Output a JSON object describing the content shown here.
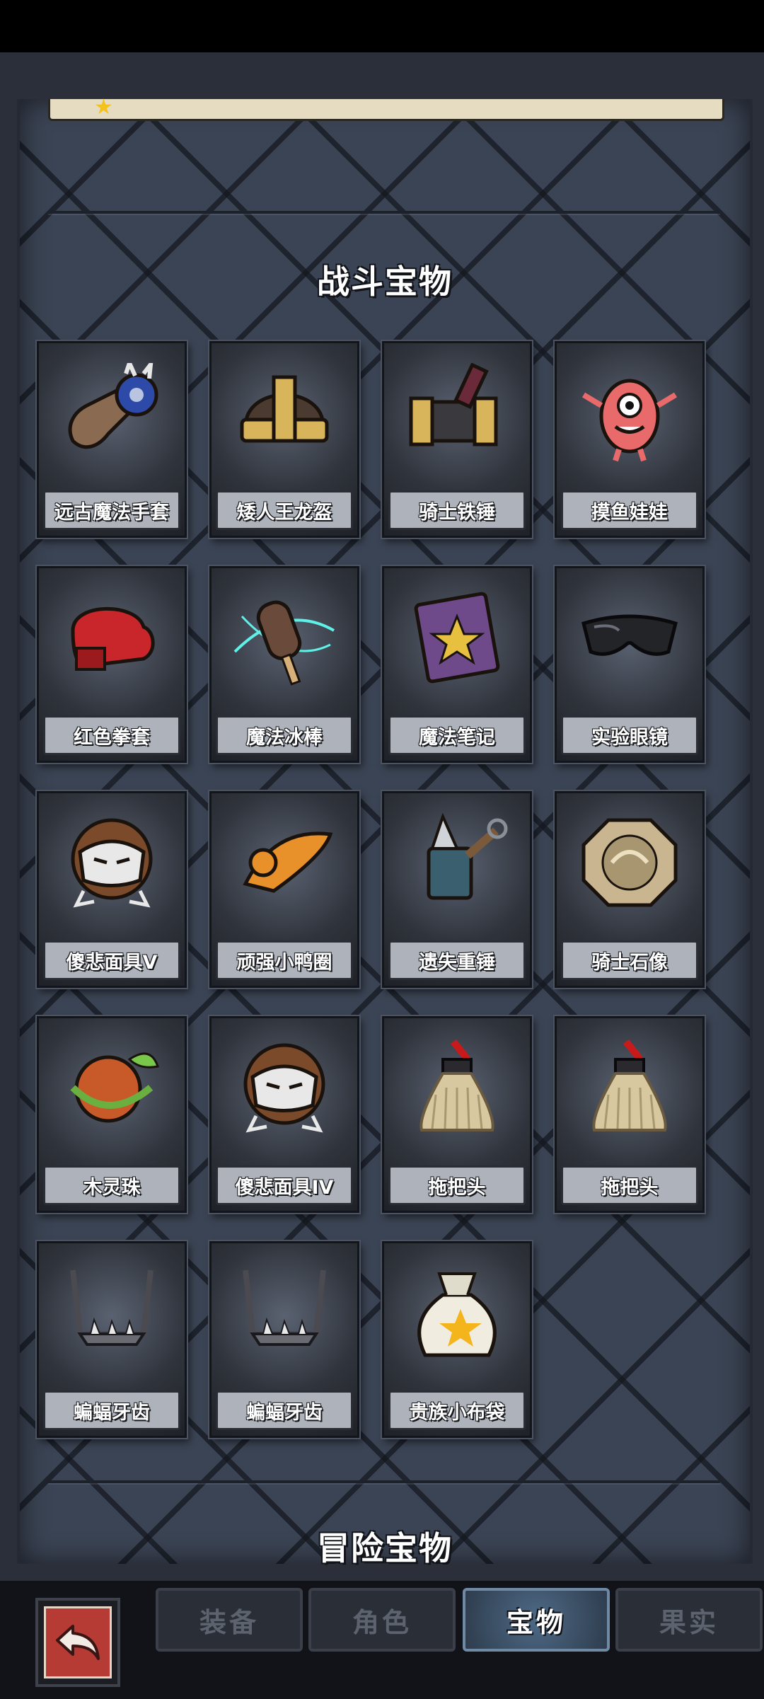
{
  "sections": {
    "battle_title": "战斗宝物",
    "adventure_title": "冒险宝物"
  },
  "treasures": [
    {
      "label": "远古魔法手套",
      "icon": "gauntlet-icon"
    },
    {
      "label": "矮人王龙盔",
      "icon": "helmet-icon"
    },
    {
      "label": "骑士铁锤",
      "icon": "hammer-icon"
    },
    {
      "label": "摸鱼娃娃",
      "icon": "pink-doll-icon"
    },
    {
      "label": "红色拳套",
      "icon": "boxing-glove-icon"
    },
    {
      "label": "魔法冰棒",
      "icon": "ice-pop-icon"
    },
    {
      "label": "魔法笔记",
      "icon": "spellbook-icon"
    },
    {
      "label": "实验眼镜",
      "icon": "goggles-icon"
    },
    {
      "label": "傻悲面具V",
      "icon": "sad-mask-icon"
    },
    {
      "label": "顽强小鸭圈",
      "icon": "duck-ring-icon"
    },
    {
      "label": "遗失重锤",
      "icon": "spiked-hammer-icon"
    },
    {
      "label": "骑士石像",
      "icon": "stone-emblem-icon"
    },
    {
      "label": "木灵珠",
      "icon": "wood-orb-icon"
    },
    {
      "label": "傻悲面具IV",
      "icon": "sad-mask-icon"
    },
    {
      "label": "拖把头",
      "icon": "mop-head-icon"
    },
    {
      "label": "拖把头",
      "icon": "mop-head-icon"
    },
    {
      "label": "蝙蝠牙齿",
      "icon": "bat-teeth-icon"
    },
    {
      "label": "蝙蝠牙齿",
      "icon": "bat-teeth-icon"
    },
    {
      "label": "贵族小布袋",
      "icon": "cloth-bag-icon"
    }
  ],
  "tabs": [
    {
      "label": "装备",
      "active": false
    },
    {
      "label": "角色",
      "active": false
    },
    {
      "label": "宝物",
      "active": true
    },
    {
      "label": "果实",
      "active": false
    }
  ],
  "colors": {
    "active_tab": "#4e6a86",
    "back_button": "#b53b34",
    "star": "#f4c21c"
  }
}
